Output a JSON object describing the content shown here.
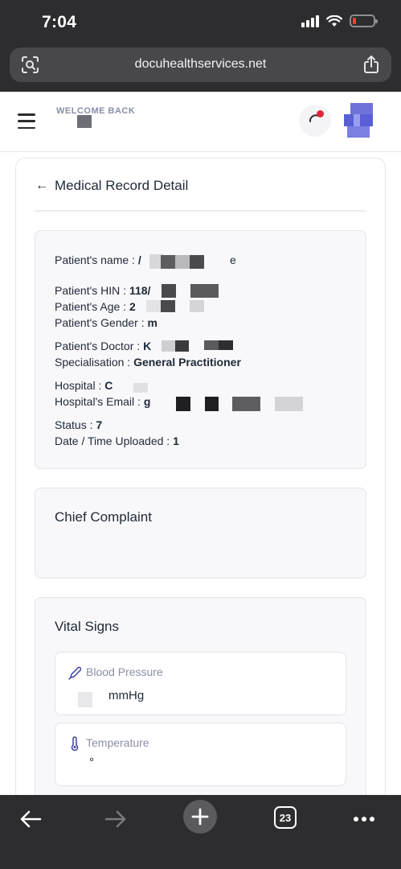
{
  "status_bar": {
    "time": "7:04"
  },
  "browser": {
    "url": "docuhealthservices.net",
    "tab_count": "23"
  },
  "header": {
    "welcome": "WELCOME BACK"
  },
  "page": {
    "back_arrow": "←",
    "title": "Medical Record Detail"
  },
  "patient": {
    "name_label": "Patient's name : ",
    "name_value": "/",
    "name_tail": "e",
    "hin_label": "Patient's HIN : ",
    "hin_value": "118/",
    "age_label": "Patient's Age : ",
    "age_value": "2",
    "gender_label": "Patient's Gender : ",
    "gender_value": "m",
    "doctor_label": "Patient's Doctor : ",
    "doctor_value": "K",
    "specialisation_label": "Specialisation : ",
    "specialisation_value": "General Practitioner",
    "hospital_label": "Hospital : ",
    "hospital_value": "C",
    "hospital_email_label": "Hospital's Email : ",
    "hospital_email_value": "g",
    "status_label": "Status : ",
    "status_value": "7",
    "uploaded_label": "Date / Time Uploaded : ",
    "uploaded_value": "1"
  },
  "complaint": {
    "title": "Chief Complaint"
  },
  "vitals": {
    "title": "Vital Signs",
    "items": [
      {
        "label": "Blood Pressure",
        "value": "mmHg",
        "icon": "pen-icon"
      },
      {
        "label": "Temperature",
        "value": "°",
        "icon": "thermometer-icon"
      }
    ]
  },
  "colors": {
    "chrome": "#2d2d2f",
    "accent": "#5a5fd6",
    "notification": "#e0253a",
    "muted_text": "#8a8fa6"
  }
}
